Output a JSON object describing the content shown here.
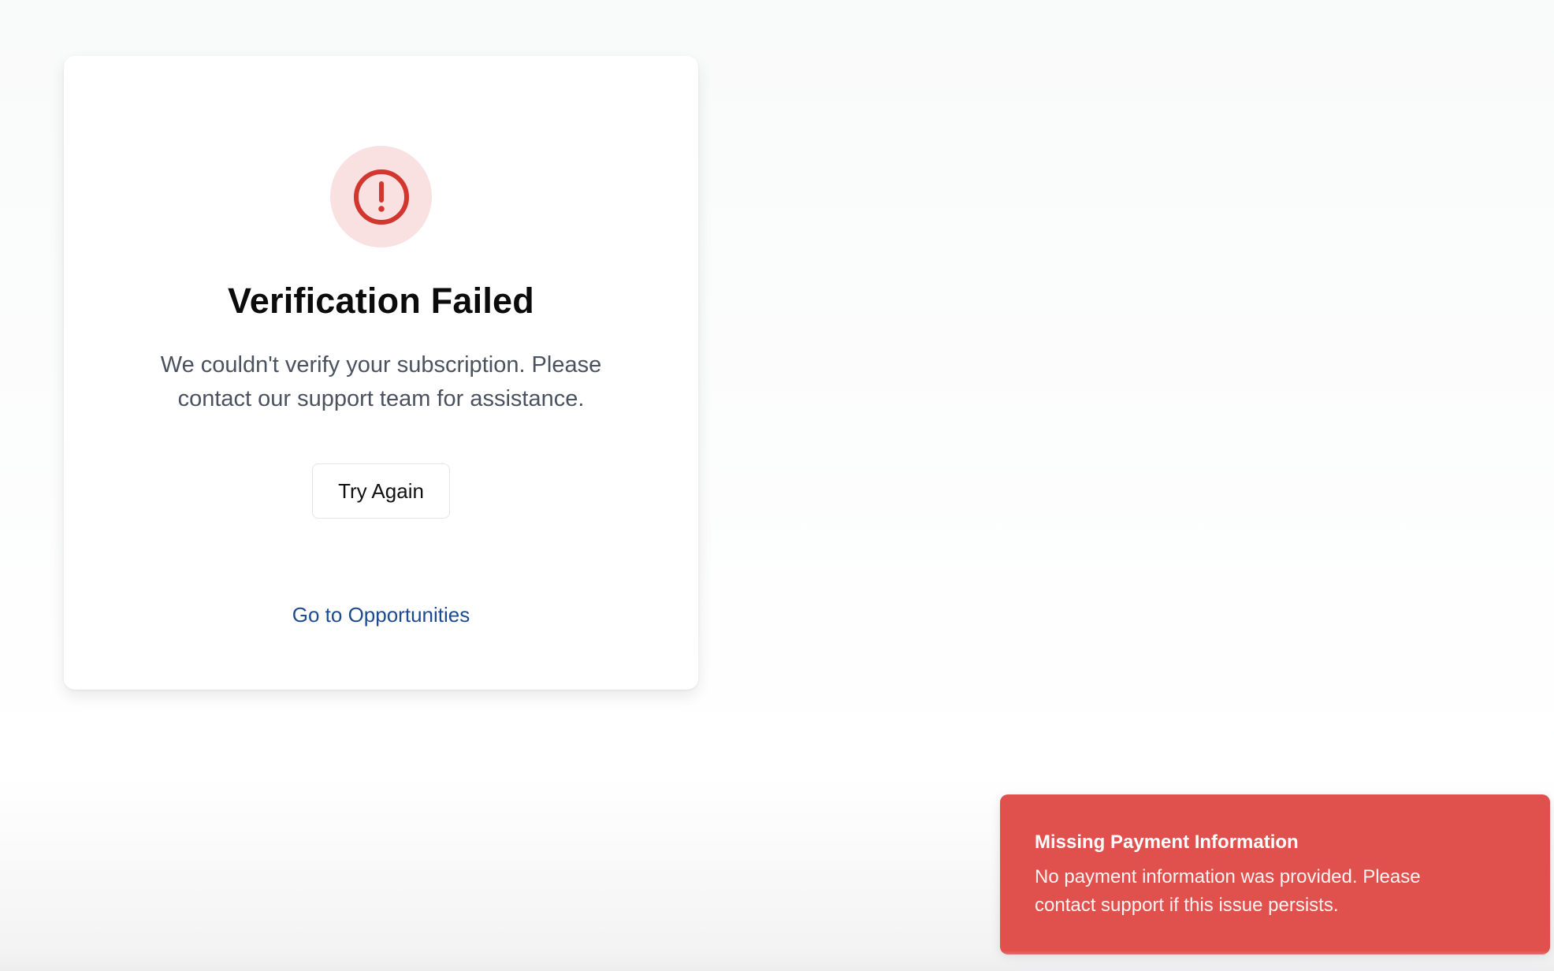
{
  "card": {
    "icon": "alert-circle-icon",
    "title": "Verification Failed",
    "message": "We couldn't verify your subscription. Please contact our support team for assistance.",
    "retry_label": "Try Again",
    "link_label": "Go to Opportunities"
  },
  "toast": {
    "title": "Missing Payment Information",
    "body": "No payment information was provided. Please contact support if this issue persists."
  },
  "colors": {
    "error": "#d1372f",
    "error_bg": "#f9e1e1",
    "toast_bg": "#e0514d",
    "link": "#1e4b8f"
  }
}
